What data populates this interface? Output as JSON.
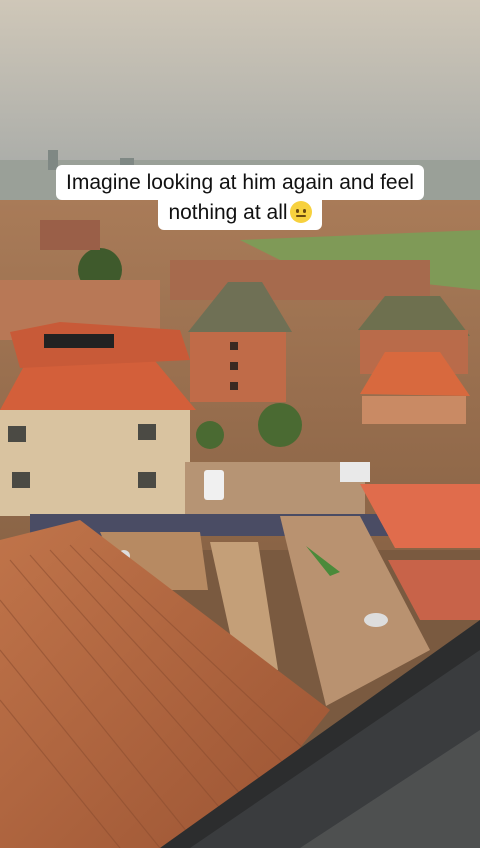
{
  "caption": {
    "line1": "Imagine looking at him again and feel",
    "line2": "nothing at all",
    "emoji_name": "neutral-face-emoji"
  },
  "colors": {
    "sky_top": "#c9c6bd",
    "sky_bottom": "#a7aaa6",
    "roof_orange": "#d9643a",
    "rust_roof": "#b86a45",
    "caption_bg": "#ffffff"
  }
}
